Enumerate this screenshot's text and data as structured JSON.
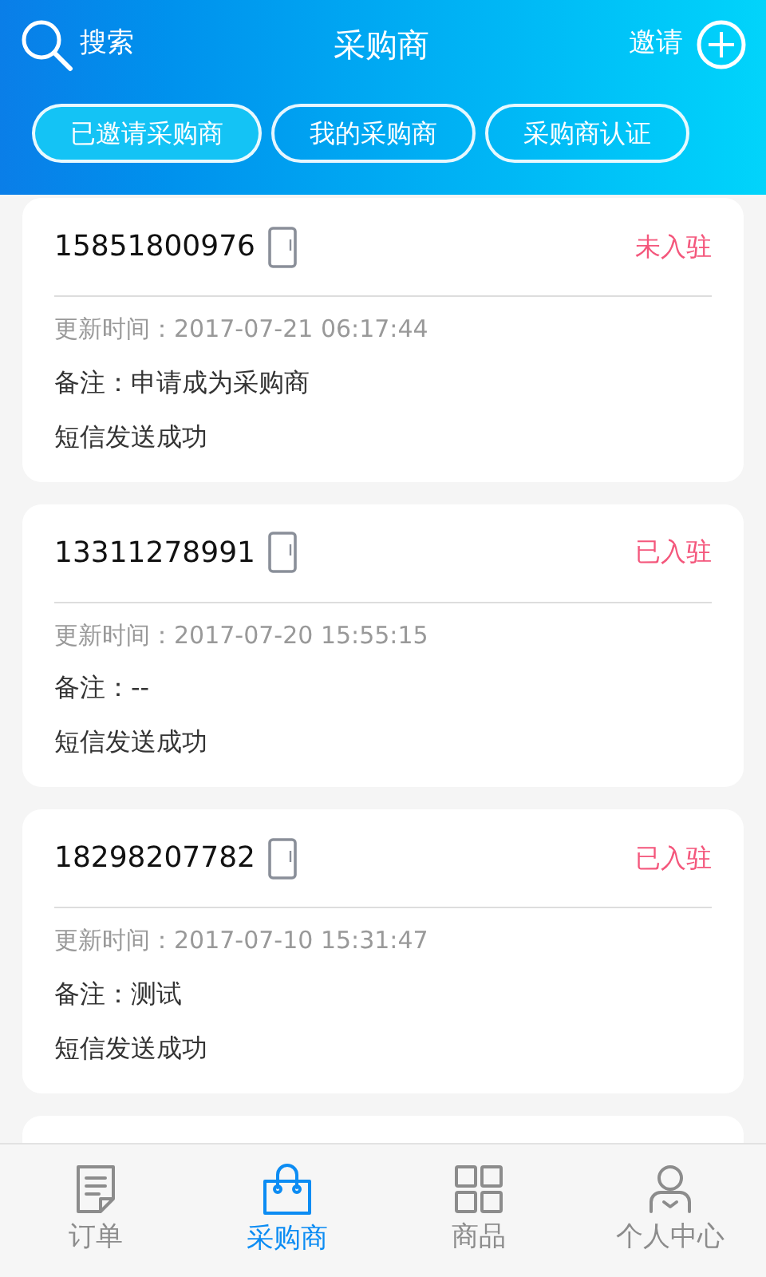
{
  "header": {
    "search_label": "搜索",
    "title": "采购商",
    "invite_label": "邀请"
  },
  "tabs": [
    {
      "label": "已邀请采购商",
      "selected": true
    },
    {
      "label": "我的采购商",
      "selected": false
    },
    {
      "label": "采购商认证",
      "selected": false
    }
  ],
  "records": [
    {
      "phone": "15851800976",
      "status": "未入驻",
      "updated": "更新时间：2017-07-21 06:17:44",
      "note": "备注：申请成为采购商",
      "sms": "短信发送成功"
    },
    {
      "phone": "13311278991",
      "status": "已入驻",
      "updated": "更新时间：2017-07-20 15:55:15",
      "note": "备注：--",
      "sms": "短信发送成功"
    },
    {
      "phone": "18298207782",
      "status": "已入驻",
      "updated": "更新时间：2017-07-10 15:31:47",
      "note": "备注：测试",
      "sms": "短信发送成功"
    }
  ],
  "bottom_nav": [
    {
      "kind": "orders",
      "label": "订单",
      "selected": false
    },
    {
      "kind": "buyers",
      "label": "采购商",
      "selected": true
    },
    {
      "kind": "products",
      "label": "商品",
      "selected": false
    },
    {
      "kind": "profile",
      "label": "个人中心",
      "selected": false
    }
  ]
}
